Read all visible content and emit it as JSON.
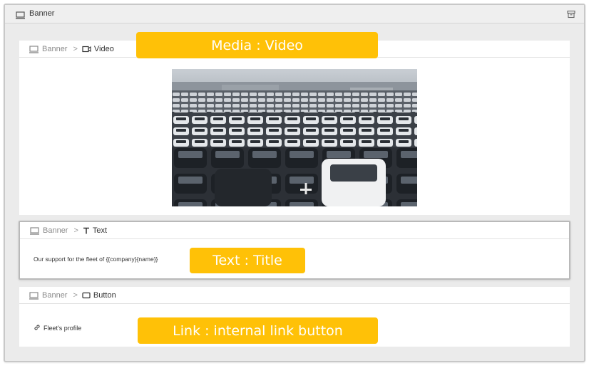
{
  "outer": {
    "title": "Banner",
    "icon": "monitor-icon",
    "action_icon": "archive-icon"
  },
  "video_card": {
    "crumb_root": "Banner",
    "crumb_sep": ">",
    "crumb_current": "Video",
    "tag": "Media : Video",
    "media_description": "parking lot full of cars"
  },
  "text_card": {
    "crumb_root": "Banner",
    "crumb_sep": ">",
    "crumb_current": "Text",
    "body": "Our support for the fleet of {{company}{name}}",
    "tag": "Text : Title"
  },
  "button_card": {
    "crumb_root": "Banner",
    "crumb_sep": ">",
    "crumb_current": "Button",
    "link_label": "Fleet's profile",
    "tag": "Link : internal link button"
  },
  "colors": {
    "tag_bg": "#ffc107",
    "panel_bg": "#ebebeb",
    "card_bg": "#ffffff"
  }
}
